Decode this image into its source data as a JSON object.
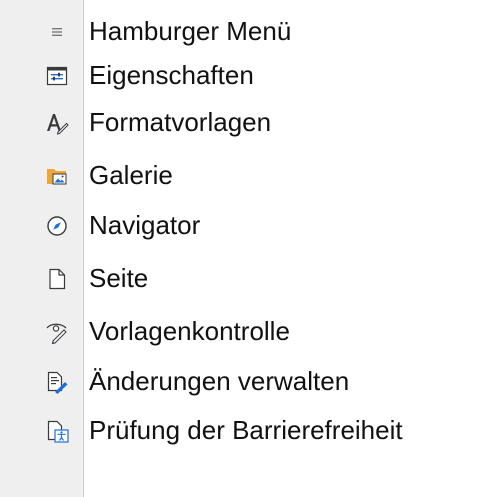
{
  "sidebar": {
    "items": [
      {
        "label": "Hamburger Menü",
        "icon": "hamburger-icon"
      },
      {
        "label": "Eigenschaften",
        "icon": "properties-icon"
      },
      {
        "label": "Formatvorlagen",
        "icon": "styles-icon"
      },
      {
        "label": "Galerie",
        "icon": "gallery-icon"
      },
      {
        "label": "Navigator",
        "icon": "navigator-icon"
      },
      {
        "label": "Seite",
        "icon": "page-icon"
      },
      {
        "label": "Vorlagenkontrolle",
        "icon": "style-inspector-icon"
      },
      {
        "label": "Änderungen verwalten",
        "icon": "manage-changes-icon"
      },
      {
        "label": "Prüfung der Barrierefreiheit",
        "icon": "accessibility-check-icon"
      }
    ]
  },
  "colors": {
    "accent_blue": "#1e6fd9",
    "folder_orange": "#f0a53a",
    "deck_background": "#efefef"
  }
}
